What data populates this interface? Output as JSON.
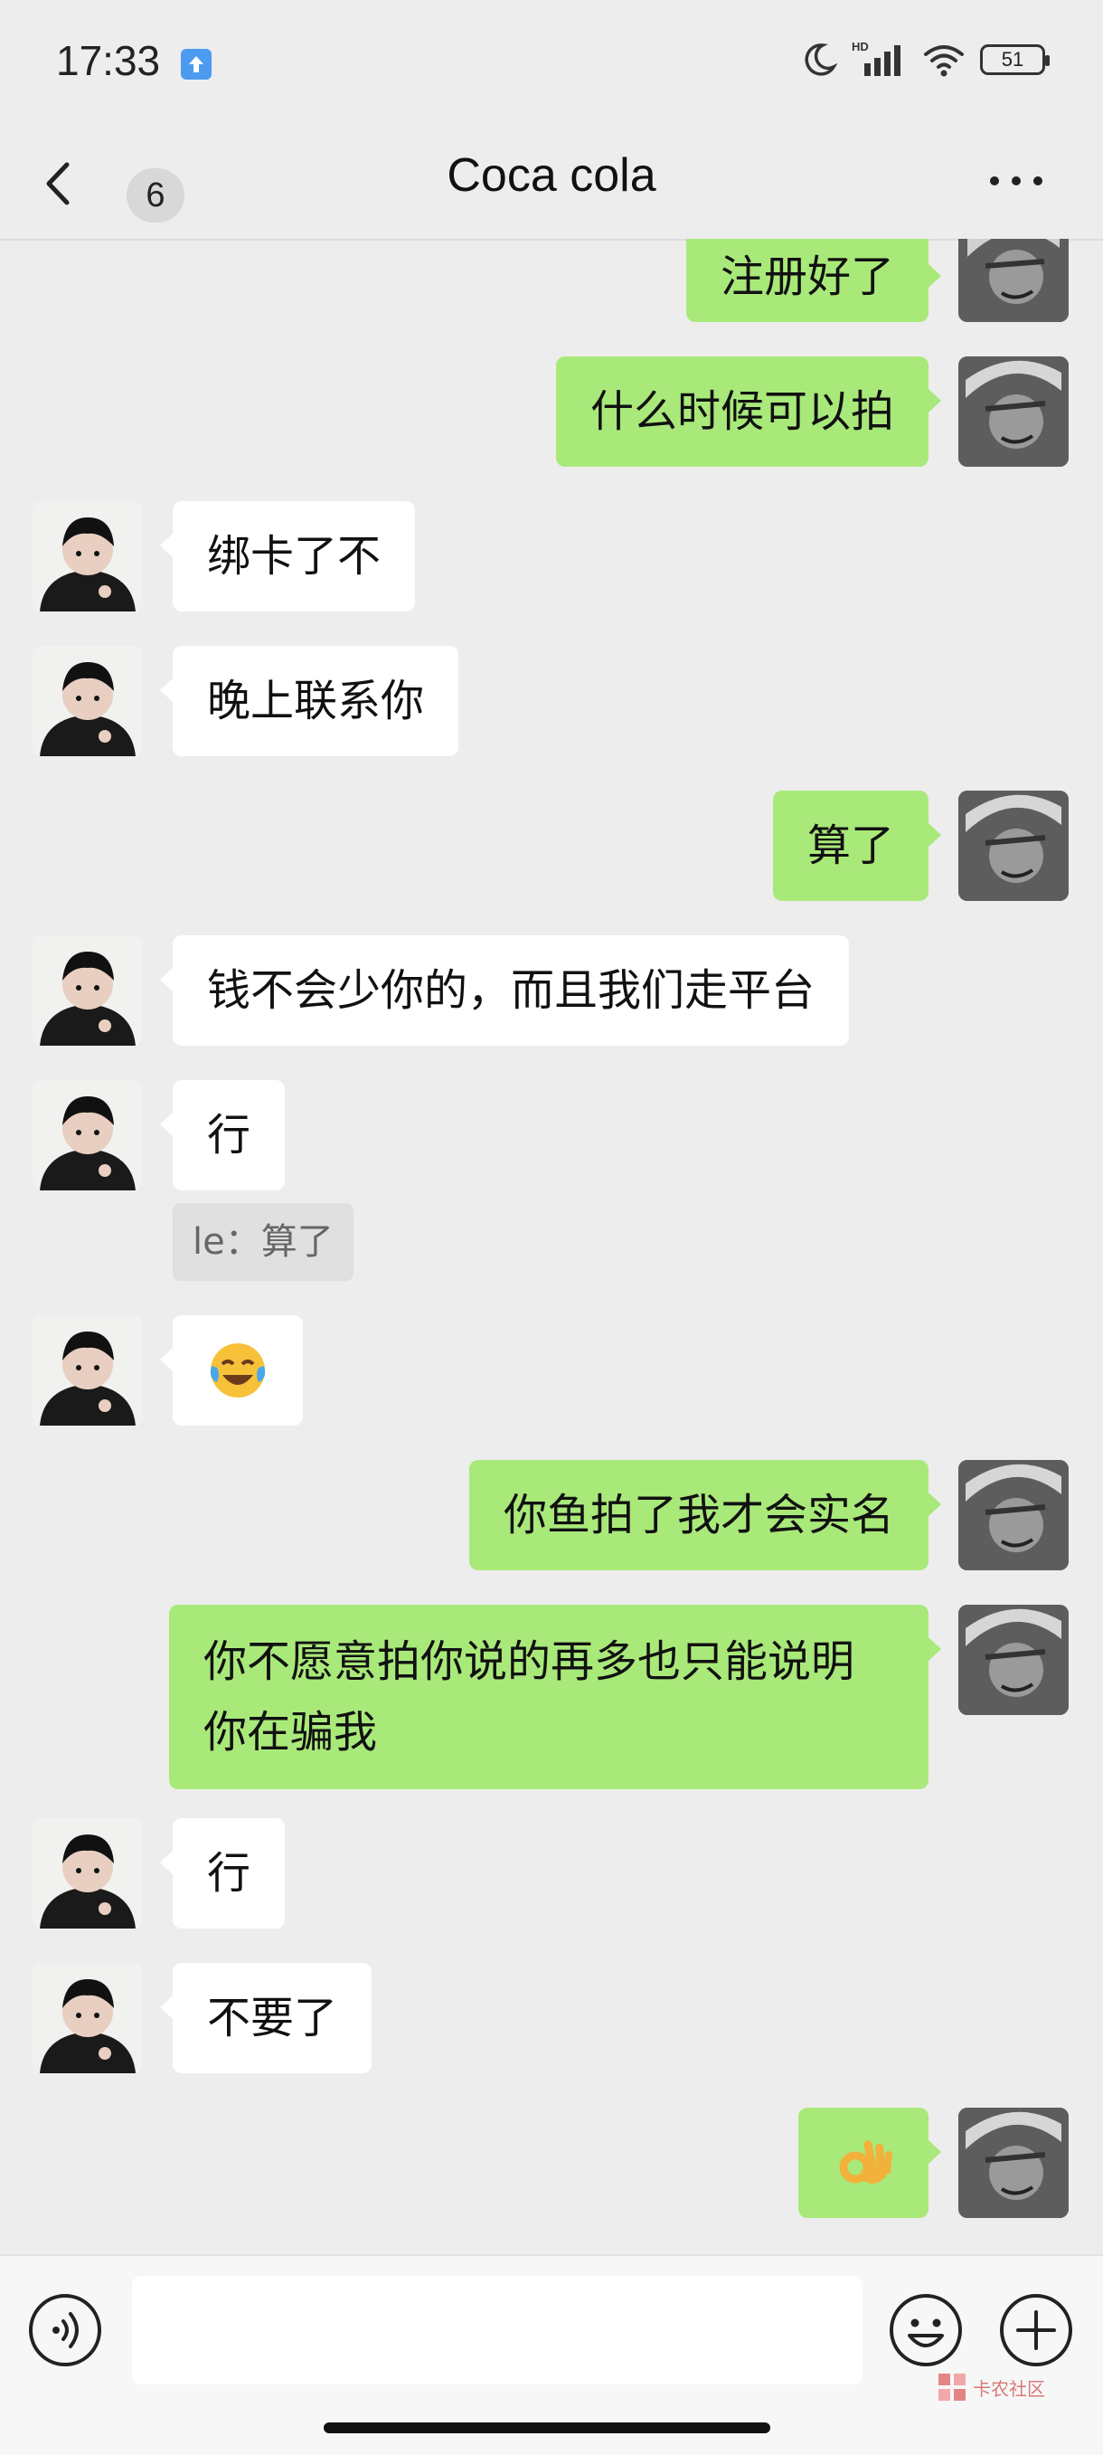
{
  "status_bar": {
    "time": "17:33",
    "network_label": "HD",
    "battery_level": "51",
    "colors": {
      "upload_badge": "#4c9bf0"
    }
  },
  "header": {
    "unread_count": "6",
    "title": "Coca cola"
  },
  "messages": [
    {
      "from": "me",
      "text": "注册好了"
    },
    {
      "from": "me",
      "text": "什么时候可以拍"
    },
    {
      "from": "them",
      "text": "绑卡了不"
    },
    {
      "from": "them",
      "text": "晚上联系你"
    },
    {
      "from": "me",
      "text": "算了"
    },
    {
      "from": "them",
      "text": "钱不会少你的，而且我们走平台"
    },
    {
      "from": "them",
      "text": "行",
      "quote": "le：算了"
    },
    {
      "from": "them",
      "emoji": "face-with-tears-of-joy"
    },
    {
      "from": "me",
      "text": "你鱼拍了我才会实名"
    },
    {
      "from": "me",
      "text": "你不愿意拍你说的再多也只能说明你在骗我"
    },
    {
      "from": "them",
      "text": "行"
    },
    {
      "from": "them",
      "text": "不要了"
    },
    {
      "from": "me",
      "emoji": "ok-hand"
    }
  ],
  "input": {
    "value": "",
    "placeholder": ""
  },
  "watermark": "卡农社区",
  "colors": {
    "background": "#ededed",
    "outgoing_bubble": "#a9e97a",
    "incoming_bubble": "#ffffff"
  }
}
